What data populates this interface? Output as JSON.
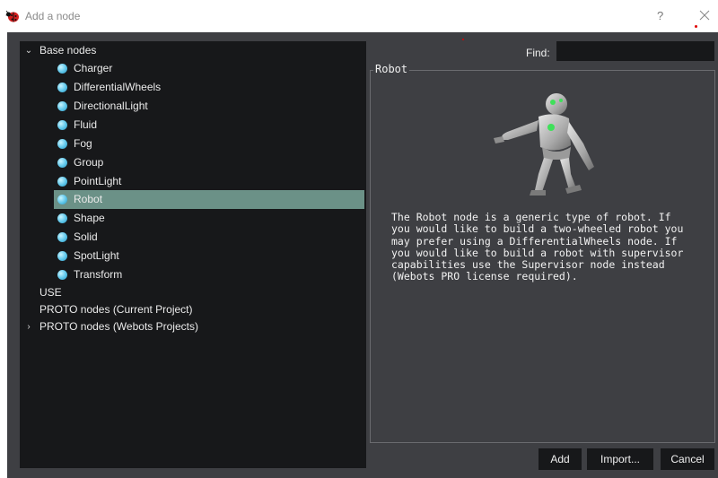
{
  "window": {
    "title": "Add a node",
    "help_label": "?"
  },
  "tree": {
    "base_nodes_label": "Base nodes",
    "base_nodes": [
      {
        "label": "Charger"
      },
      {
        "label": "DifferentialWheels"
      },
      {
        "label": "DirectionalLight"
      },
      {
        "label": "Fluid"
      },
      {
        "label": "Fog"
      },
      {
        "label": "Group"
      },
      {
        "label": "PointLight"
      },
      {
        "label": "Robot",
        "selected": true
      },
      {
        "label": "Shape"
      },
      {
        "label": "Solid"
      },
      {
        "label": "SpotLight"
      },
      {
        "label": "Transform"
      }
    ],
    "use_label": "USE",
    "proto_current_label": "PROTO nodes (Current Project)",
    "proto_webots_label": "PROTO nodes (Webots Projects)"
  },
  "find": {
    "label": "Find:",
    "value": ""
  },
  "info": {
    "group_title": "Robot",
    "description": "The Robot node is a generic type of robot. If\nyou would like to build a two-wheeled robot you\nmay prefer using a DifferentialWheels node. If\nyou would like to build a robot with supervisor\ncapabilities use the Supervisor node instead\n(Webots PRO license required)."
  },
  "buttons": {
    "add": "Add",
    "import": "Import...",
    "cancel": "Cancel"
  },
  "colors": {
    "dialog_bg": "#3e3f43",
    "tree_bg": "#17181a",
    "selection": "#6b9187",
    "node_icon": "#5cc6ea"
  }
}
